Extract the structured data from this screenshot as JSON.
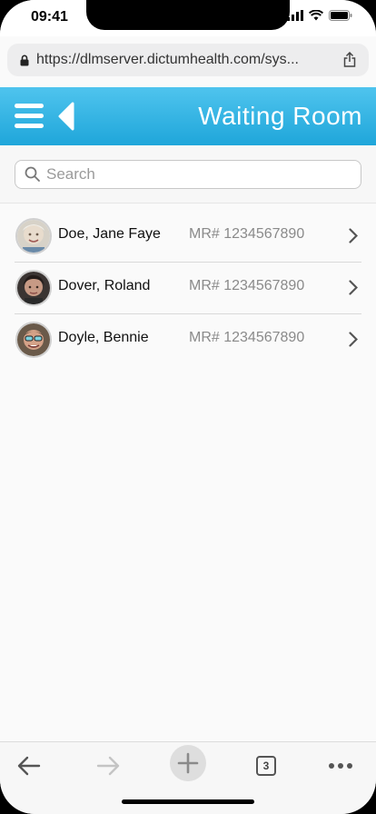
{
  "status_bar": {
    "time": "09:41"
  },
  "browser": {
    "url": "https://dlmserver.dictumhealth.com/sys...",
    "tabs_count": "3"
  },
  "header": {
    "title": "Waiting Room"
  },
  "search": {
    "placeholder": "Search"
  },
  "patients": [
    {
      "name": "Doe, Jane Faye",
      "mr": "MR# 1234567890"
    },
    {
      "name": "Dover, Roland",
      "mr": "MR# 1234567890"
    },
    {
      "name": "Doyle, Bennie",
      "mr": "MR# 1234567890"
    }
  ],
  "colors": {
    "header_top": "#4fc4ee",
    "header_bottom": "#1fa6da"
  }
}
